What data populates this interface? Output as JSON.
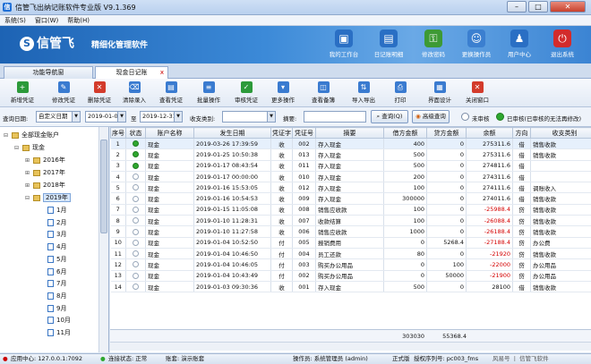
{
  "window": {
    "title": "信管飞出纳记账软件专业版 V9.1.369",
    "min": "–",
    "max": "□",
    "close": "✕"
  },
  "menu": [
    "系统(S)",
    "窗口(W)",
    "帮助(H)"
  ],
  "banner": {
    "logo_mark": "S",
    "logo": "信管飞",
    "slogan": "精细化管理软件",
    "buttons": [
      {
        "label": "我的工作台",
        "icon": "desktop-icon",
        "glyph": "▣",
        "color": "#2a6fc4"
      },
      {
        "label": "日记账明细",
        "icon": "ledger-icon",
        "glyph": "▤",
        "color": "#2a6fc4"
      },
      {
        "label": "修改密码",
        "icon": "key-icon",
        "glyph": "⚿",
        "color": "#3d9a35"
      },
      {
        "label": "更换操作员",
        "icon": "user-icon",
        "glyph": "☺",
        "color": "#3b7fd0"
      },
      {
        "label": "用户中心",
        "icon": "user-center-icon",
        "glyph": "♟",
        "color": "#2a6fc4"
      },
      {
        "label": "退出系统",
        "icon": "power-icon",
        "glyph": "⏻",
        "color": "#d32b2b"
      }
    ]
  },
  "tabs": [
    {
      "label": "功能导航窗"
    },
    {
      "label": "现金日记账",
      "close": "x"
    }
  ],
  "toolbar": [
    {
      "label": "新增凭证",
      "glyph": "+",
      "color": "#2c9a3a"
    },
    {
      "label": "修改凭证",
      "glyph": "✎",
      "color": "#3a7bd0"
    },
    {
      "label": "删除凭证",
      "glyph": "✕",
      "color": "#d33b2b"
    },
    {
      "label": "清除录入",
      "glyph": "⌫",
      "color": "#3a7bd0"
    },
    {
      "label": "查看凭证",
      "glyph": "▤",
      "color": "#3a7bd0"
    },
    {
      "label": "批量操作",
      "glyph": "≡",
      "color": "#3a7bd0"
    },
    {
      "label": "审核凭证",
      "glyph": "✓",
      "color": "#2c9a3a"
    },
    {
      "label": "更多操作",
      "glyph": "▾",
      "color": "#3a7bd0"
    },
    {
      "label": "查看备簿",
      "glyph": "◫",
      "color": "#3a7bd0"
    },
    {
      "label": "导入导出",
      "glyph": "⇅",
      "color": "#3a7bd0"
    },
    {
      "label": "打印",
      "glyph": "⎙",
      "color": "#3a7bd0"
    },
    {
      "label": "界面设计",
      "glyph": "▦",
      "color": "#3a7bd0"
    },
    {
      "label": "关闭窗口",
      "glyph": "✕",
      "color": "#d33b2b"
    }
  ],
  "query": {
    "date_label": "查询日期:",
    "date_mode": "自定义日期",
    "date_from": "2019-01-01",
    "to": "至",
    "date_to": "2019-12-31",
    "category_label": "收支类别:",
    "category": "",
    "summary_label": "摘要:",
    "summary": "",
    "search_btn": "查询(Q)",
    "advanced_btn": "高级查询",
    "unaudited": "未审核",
    "audited": "已审核(已审核的无法再修改)"
  },
  "tree": {
    "root": "全部现金账户",
    "account": "现金",
    "years": [
      "2016年",
      "2017年",
      "2018年",
      "2019年"
    ],
    "months": [
      "1月",
      "2月",
      "3月",
      "4月",
      "5月",
      "6月",
      "7月",
      "8月",
      "9月",
      "10月",
      "11月"
    ]
  },
  "grid": {
    "headers": [
      "序号",
      "状态",
      "账户名称",
      "发生日期",
      "凭证字",
      "凭证号",
      "摘要",
      "借方金额",
      "贷方金额",
      "余额",
      "方向",
      "收支类别"
    ],
    "rows": [
      [
        "1",
        "g",
        "现金",
        "2019-03-26 17:39:59",
        "收",
        "002",
        "存入现金",
        "400",
        "0",
        "275311.6",
        "借",
        "销售收款"
      ],
      [
        "2",
        "g",
        "现金",
        "2019-01-25 10:50:38",
        "收",
        "013",
        "存入现金",
        "500",
        "0",
        "275311.6",
        "借",
        "销售收款"
      ],
      [
        "3",
        "g",
        "现金",
        "2019-01-17 08:43:54",
        "收",
        "011",
        "存入现金",
        "500",
        "0",
        "274811.6",
        "借",
        ""
      ],
      [
        "4",
        "w",
        "现金",
        "2019-01-17 00:00:00",
        "收",
        "010",
        "存入现金",
        "200",
        "0",
        "274311.6",
        "借",
        ""
      ],
      [
        "5",
        "w",
        "现金",
        "2019-01-16 15:53:05",
        "收",
        "012",
        "存入现金",
        "100",
        "0",
        "274111.6",
        "借",
        "调账收入"
      ],
      [
        "6",
        "w",
        "现金",
        "2019-01-16 10:54:53",
        "收",
        "009",
        "存入现金",
        "300000",
        "0",
        "274011.6",
        "借",
        "销售收款"
      ],
      [
        "7",
        "w",
        "现金",
        "2019-01-15 11:05:08",
        "收",
        "008",
        "销售应收款",
        "100",
        "0",
        "-25988.4",
        "贷",
        "销售收款"
      ],
      [
        "8",
        "w",
        "现金",
        "2019-01-10 11:28:31",
        "收",
        "007",
        "收款结算",
        "100",
        "0",
        "-26088.4",
        "贷",
        "销售收款"
      ],
      [
        "9",
        "w",
        "现金",
        "2019-01-10 11:27:58",
        "收",
        "006",
        "销售应收款",
        "1000",
        "0",
        "-26188.4",
        "贷",
        "销售收款"
      ],
      [
        "10",
        "w",
        "现金",
        "2019-01-04 10:52:50",
        "付",
        "005",
        "报销费用",
        "0",
        "5268.4",
        "-27188.4",
        "贷",
        "办公费"
      ],
      [
        "11",
        "w",
        "现金",
        "2019-01-04 10:46:50",
        "付",
        "004",
        "员工还款",
        "80",
        "0",
        "-21920",
        "贷",
        "销售收款"
      ],
      [
        "12",
        "w",
        "现金",
        "2019-01-04 10:46:05",
        "付",
        "003",
        "购买办公用品",
        "0",
        "100",
        "-22000",
        "贷",
        "办公用品"
      ],
      [
        "13",
        "w",
        "现金",
        "2019-01-04 10:43:49",
        "付",
        "002",
        "购买办公用品",
        "0",
        "50000",
        "-21900",
        "贷",
        "办公用品"
      ],
      [
        "14",
        "w",
        "现金",
        "2019-01-03 09:30:36",
        "收",
        "001",
        "存入现金",
        "500",
        "0",
        "28100",
        "借",
        "销售收款"
      ]
    ],
    "total_debit": "303030",
    "total_credit": "55368.4"
  },
  "status": {
    "app_center": "应用中心:  127.0.0.1:7092",
    "conn": "连接状态: 正常",
    "account": "账套: 演示账套",
    "operator": "操作员: 系统管理员 (admin)",
    "edition": "正式版",
    "license": "授权序列号: pc003_fms",
    "watermark": "风易号 丨 信管飞软件"
  }
}
